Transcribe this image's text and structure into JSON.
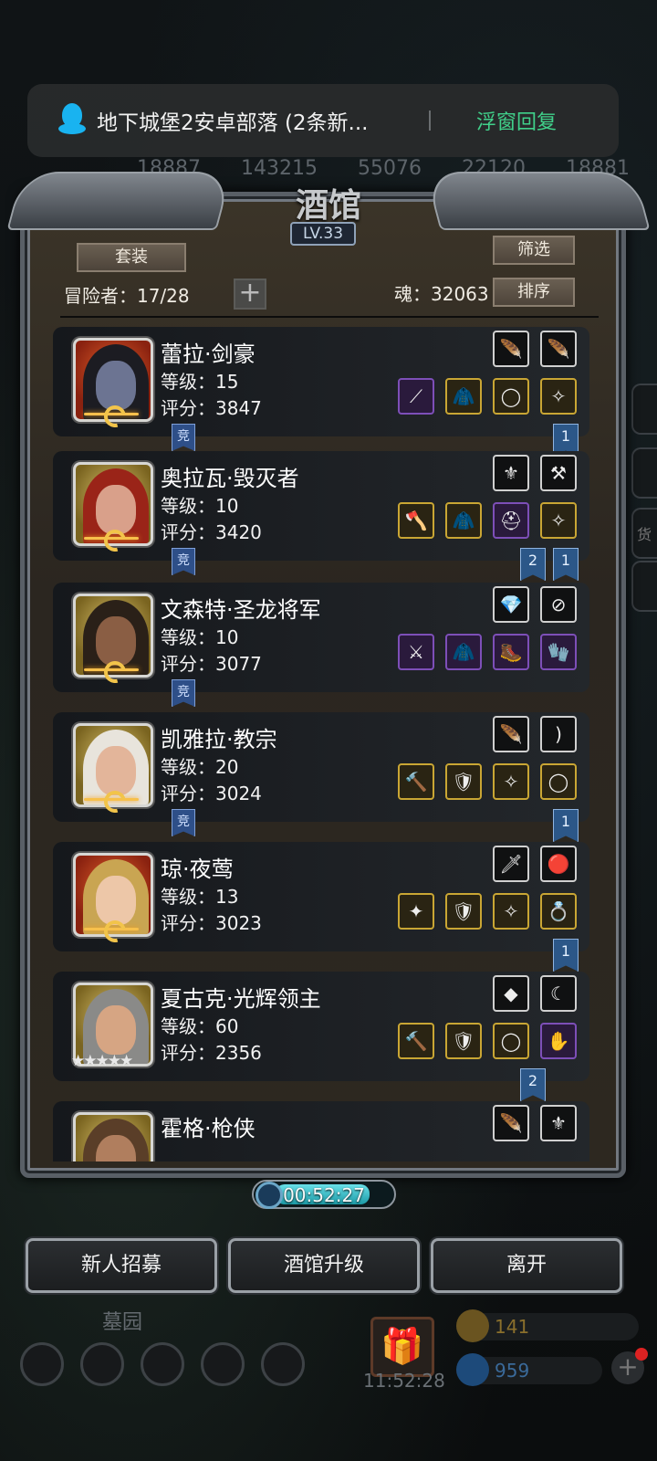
{
  "background": {
    "stats": [
      "18887",
      "143215",
      "55076",
      "22120",
      "18881"
    ],
    "area_label": "墓园",
    "clock": "11:52:28",
    "gold": "141",
    "gems": "959",
    "side_tab_char": "货"
  },
  "notification": {
    "text": "地下城堡2安卓部落 (2条新...",
    "action": "浮窗回复"
  },
  "panel": {
    "title": "酒馆",
    "level": "LV.33",
    "set_button": "套装",
    "filter_button": "筛选",
    "sort_button": "排序",
    "adventurers": "冒险者：17/28",
    "plus": "+",
    "soul": "魂：32063"
  },
  "heroes": [
    {
      "name": "蕾拉·剑豪",
      "level": "等级：15",
      "score": "评分：3847",
      "jing": "竞",
      "tags": [
        "1"
      ]
    },
    {
      "name": "奥拉瓦·毁灭者",
      "level": "等级：10",
      "score": "评分：3420",
      "jing": "竞",
      "tags": [
        "2",
        "1"
      ]
    },
    {
      "name": "文森特·圣龙将军",
      "level": "等级：10",
      "score": "评分：3077",
      "jing": "竞",
      "tags": []
    },
    {
      "name": "凯雅拉·教宗",
      "level": "等级：20",
      "score": "评分：3024",
      "jing": "竞",
      "tags": [
        "1"
      ]
    },
    {
      "name": "琼·夜莺",
      "level": "等级：13",
      "score": "评分：3023",
      "jing": "",
      "tags": [
        "1"
      ]
    },
    {
      "name": "夏古克·光辉领主",
      "level": "等级：60",
      "score": "评分：2356",
      "jing": "",
      "tags": [
        "2"
      ],
      "stars": "★★★★★"
    },
    {
      "name": "霍格·枪侠",
      "level": "",
      "score": "",
      "jing": "",
      "tags": []
    }
  ],
  "timer": {
    "text": "00:52:27",
    "progress": 0.82
  },
  "buttons": {
    "recruit": "新人招募",
    "upgrade": "酒馆升级",
    "leave": "离开"
  },
  "colors": {
    "accent_green": "#40d08a",
    "tag_blue": "#2c5788",
    "gold_frame": "#c9a634",
    "purple_frame": "#7d4fb8"
  }
}
